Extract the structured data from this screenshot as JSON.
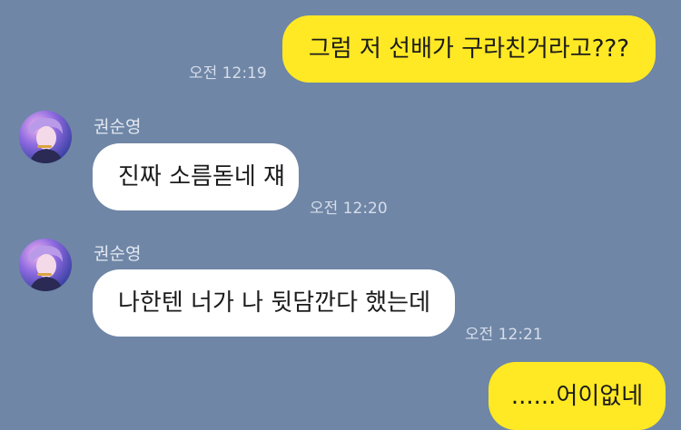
{
  "messages": [
    {
      "direction": "outgoing",
      "text": "그럼 저 선배가 구라친거라고???",
      "time": "오전 12:19"
    },
    {
      "direction": "incoming",
      "sender": "권순영",
      "avatar_icon": "profile-photo-icon",
      "text": "진짜 소름돋네 쟤",
      "time": "오전 12:20"
    },
    {
      "direction": "incoming",
      "sender": "권순영",
      "avatar_icon": "profile-photo-icon",
      "text": "나한텐 너가 나 뒷담깐다 했는데",
      "time": "오전 12:21"
    },
    {
      "direction": "outgoing",
      "text": "......어이없네"
    }
  ],
  "colors": {
    "background": "#6F86A6",
    "outgoing_bubble": "#FFE924",
    "incoming_bubble": "#FFFFFF"
  }
}
